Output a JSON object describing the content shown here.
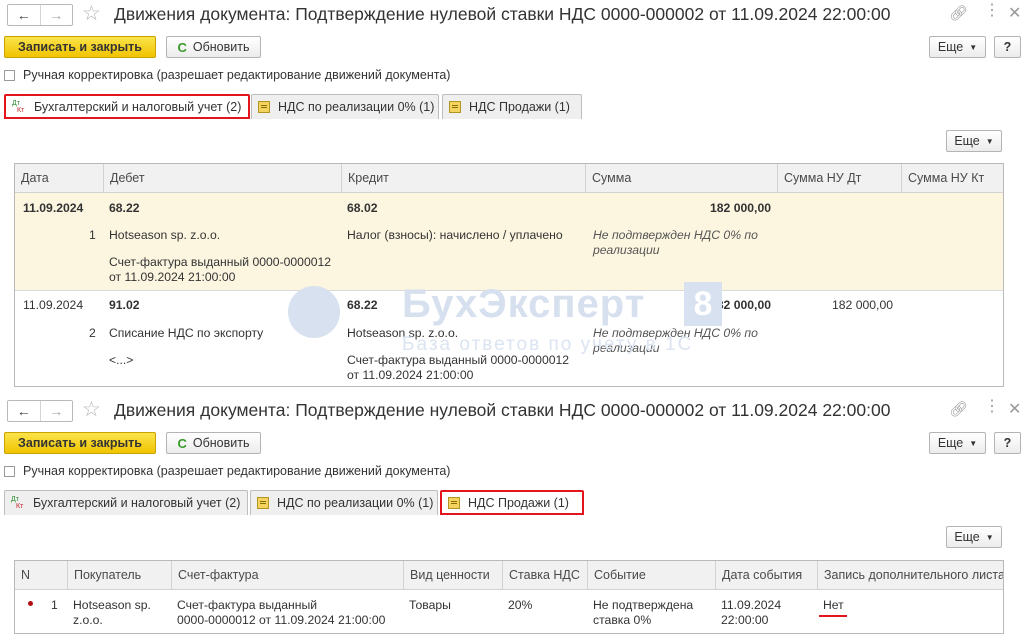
{
  "windows": [
    {
      "title": "Движения документа: Подтверждение нулевой ставки НДС 0000-000002 от 11.09.2024 22:00:00",
      "nav": {
        "back": "←",
        "forward": "→"
      },
      "toolbar": {
        "save_close": "Записать и закрыть",
        "refresh": "Обновить",
        "more": "Еще",
        "help": "?"
      },
      "manual_edit": "Ручная корректировка (разрешает редактирование движений документа)",
      "tabs": [
        {
          "icon_dt": "Дт",
          "icon_kt": "Кт",
          "label": "Бухгалтерский и налоговый учет (2)"
        },
        {
          "label": "НДС по реализации 0% (1)"
        },
        {
          "label": "НДС Продажи (1)"
        }
      ],
      "active_tab": 0,
      "grid_more": "Еще",
      "grid": {
        "columns": [
          "Дата",
          "Дебет",
          "Кредит",
          "Сумма",
          "Сумма НУ Дт",
          "Сумма НУ Кт"
        ],
        "rows": [
          {
            "date": "11.09.2024",
            "num": "1",
            "debit_account": "68.22",
            "debit_sub": [
              "Hotseason sp. z.o.o.",
              "Счет-фактура выданный 0000-0000012",
              "от 11.09.2024 21:00:00"
            ],
            "credit_account": "68.02",
            "credit_sub": [
              "Налог (взносы): начислено / уплачено"
            ],
            "amount": "182 000,00",
            "note": [
              "Не подтвержден НДС 0% по",
              "реализации"
            ],
            "nu_dt": "",
            "nu_kt": ""
          },
          {
            "date": "11.09.2024",
            "num": "2",
            "debit_account": "91.02",
            "debit_sub": [
              "Списание НДС по экспорту",
              "<...>"
            ],
            "credit_account": "68.22",
            "credit_sub": [
              "Hotseason sp. z.o.o.",
              "Счет-фактура выданный 0000-0000012",
              "от 11.09.2024 21:00:00"
            ],
            "amount": "182 000,00",
            "note": [
              "Не подтвержден НДС 0% по",
              "реализации"
            ],
            "nu_dt": "182 000,00",
            "nu_kt": ""
          }
        ]
      }
    },
    {
      "title": "Движения документа: Подтверждение нулевой ставки НДС 0000-000002 от 11.09.2024 22:00:00",
      "nav": {
        "back": "←",
        "forward": "→"
      },
      "toolbar": {
        "save_close": "Записать и закрыть",
        "refresh": "Обновить",
        "more": "Еще",
        "help": "?"
      },
      "manual_edit": "Ручная корректировка (разрешает редактирование движений документа)",
      "tabs": [
        {
          "icon_dt": "Дт",
          "icon_kt": "Кт",
          "label": "Бухгалтерский и налоговый учет (2)"
        },
        {
          "label": "НДС по реализации 0% (1)"
        },
        {
          "label": "НДС Продажи (1)"
        }
      ],
      "active_tab": 2,
      "grid_more": "Еще",
      "grid": {
        "columns": [
          "N",
          "Покупатель",
          "Счет-фактура",
          "Вид ценности",
          "Ставка НДС",
          "Событие",
          "Дата события",
          "Запись дополнительного листа"
        ],
        "rows": [
          {
            "n": "1",
            "buyer": [
              "Hotseason sp.",
              "z.o.o."
            ],
            "invoice": [
              "Счет-фактура выданный",
              "0000-0000012 от 11.09.2024 21:00:00"
            ],
            "value_type": "Товары",
            "rate": "20%",
            "event": [
              "Не подтверждена",
              "ставка 0%"
            ],
            "event_date": [
              "11.09.2024",
              "22:00:00"
            ],
            "extra_sheet": "Нет"
          }
        ]
      }
    }
  ],
  "watermark": {
    "brand": "БухЭксперт",
    "digit": "8",
    "subtitle": "База ответов по учету в 1С"
  },
  "colors": {
    "accent_yellow": "#f0c400",
    "highlight_red": "#e4141b",
    "selected_row": "#fcf5e0",
    "header_bg": "#f1f1f1"
  },
  "icons": {
    "favorite": "star-icon",
    "link": "link-icon",
    "more": "more-icon",
    "close": "close-icon",
    "refresh": "refresh-icon"
  }
}
